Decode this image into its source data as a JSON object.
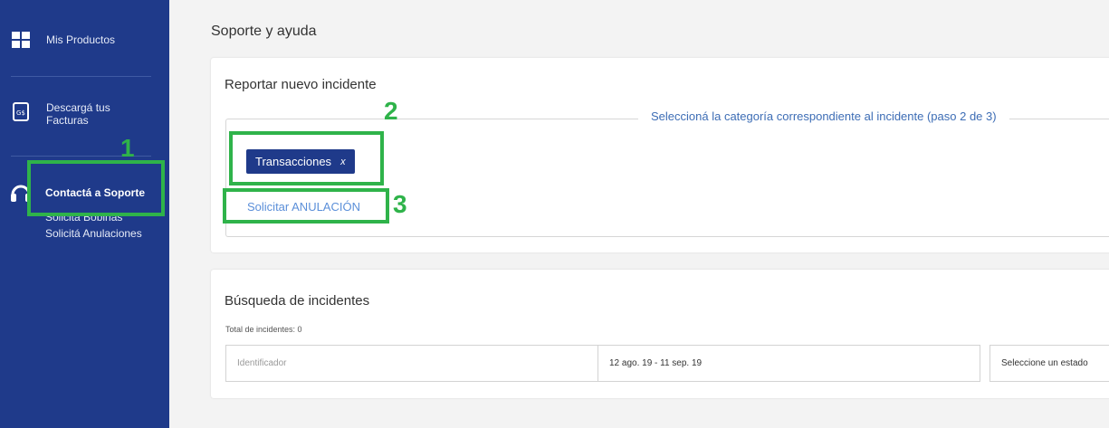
{
  "sidebar": {
    "items": [
      {
        "label": "Mis Productos",
        "icon": "grid-icon"
      },
      {
        "label": "Descargá tus\nFacturas",
        "icon": "invoice-icon"
      },
      {
        "label": "Contactá a Soporte",
        "icon": "headset-icon"
      }
    ],
    "sub_links": [
      "Solicitá Bobinas",
      "Solicitá Anulaciones"
    ]
  },
  "page": {
    "title": "Soporte y ayuda"
  },
  "report": {
    "title": "Reportar nuevo incidente",
    "legend": "Seleccioná la categoría correspondiente al incidente (paso 2 de 3)",
    "chip_label": "Transacciones",
    "chip_close": "x",
    "action_link": "Solicitar ANULACIÓN"
  },
  "search": {
    "title": "Búsqueda de incidentes",
    "total": "Total de incidentes: 0",
    "id_placeholder": "Identificador",
    "date_range": "12 ago. 19 - 11 sep. 19",
    "state_placeholder": "Seleccione un estado"
  },
  "annotations": {
    "step1": "1",
    "step2": "2",
    "step3": "3",
    "color": "#2fb34a"
  },
  "colors": {
    "sidebar": "#1f3a8a",
    "accent_link": "#5b8fd9",
    "chip": "#1f3a8a"
  }
}
